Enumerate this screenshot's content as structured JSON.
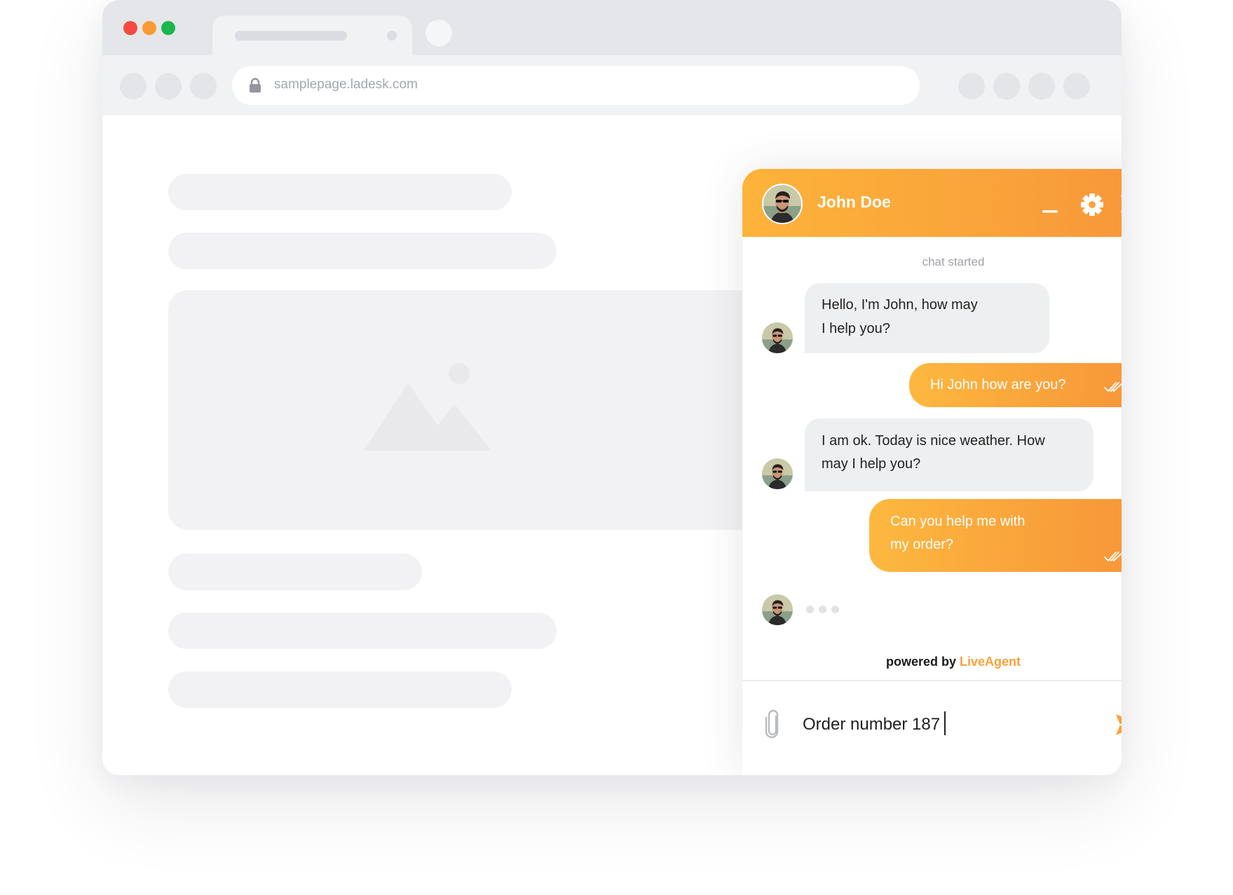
{
  "browser": {
    "address": "samplepage.ladesk.com",
    "traffic_colors": [
      "#f54a3f",
      "#f99a32",
      "#1bb64c"
    ]
  },
  "chat": {
    "agent_name": "John Doe",
    "status_text": "chat started",
    "icons": [
      "minimize-icon",
      "gear-icon",
      "close-icon",
      "paperclip-icon",
      "send-icon",
      "double-check-icon"
    ],
    "messages": [
      {
        "from": "agent",
        "lines": [
          "Hello, I'm John, how may",
          "I help you?"
        ]
      },
      {
        "from": "visitor",
        "lines": [
          "Hi John how are you?"
        ]
      },
      {
        "from": "agent",
        "lines": [
          "I am ok. Today is nice weather. How",
          "may I help you?"
        ]
      },
      {
        "from": "visitor",
        "lines": [
          "Can you help me with",
          "my order?"
        ]
      }
    ],
    "powered_prefix": "powered by",
    "powered_brand": "LiveAgent",
    "input_value": "Order number 187",
    "accent_color": "#f9a33a"
  }
}
